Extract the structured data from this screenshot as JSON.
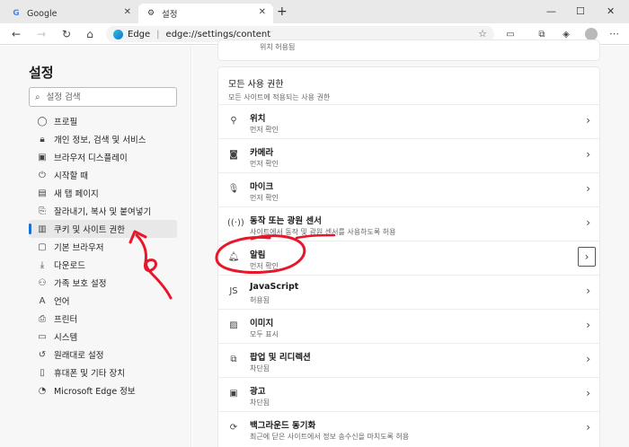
{
  "tabs": [
    {
      "title": "Google",
      "icon": "google-icon",
      "active": false
    },
    {
      "title": "설정",
      "icon": "gear-icon",
      "active": true
    }
  ],
  "address_bar": {
    "browser_name": "Edge",
    "url": "edge://settings/content"
  },
  "sidebar": {
    "title": "설정",
    "search_placeholder": "설정 검색",
    "items": [
      {
        "label": "프로필",
        "icon": "profile-icon"
      },
      {
        "label": "개인 정보, 검색 및 서비스",
        "icon": "lock-icon"
      },
      {
        "label": "브라우저 디스플레이",
        "icon": "display-icon"
      },
      {
        "label": "시작할 때",
        "icon": "power-icon"
      },
      {
        "label": "새 탭 페이지",
        "icon": "newtab-icon"
      },
      {
        "label": "잘라내기, 복사 및 붙여넣기",
        "icon": "clipboard-icon"
      },
      {
        "label": "쿠키 및 사이트 권한",
        "icon": "cookie-icon",
        "active": true
      },
      {
        "label": "기본 브라우저",
        "icon": "browser-icon"
      },
      {
        "label": "다운로드",
        "icon": "download-icon"
      },
      {
        "label": "가족 보호 설정",
        "icon": "family-icon"
      },
      {
        "label": "언어",
        "icon": "language-icon"
      },
      {
        "label": "프린터",
        "icon": "printer-icon"
      },
      {
        "label": "시스템",
        "icon": "system-icon"
      },
      {
        "label": "원래대로 설정",
        "icon": "reset-icon"
      },
      {
        "label": "휴대폰 및 기타 장치",
        "icon": "phone-icon"
      },
      {
        "label": "Microsoft Edge 정보",
        "icon": "edge-icon"
      }
    ]
  },
  "main": {
    "top_card_sub": "위치 허용됨",
    "section_title": "모든 사용 권한",
    "section_sub": "모든 사이트에 적용되는 사용 권한",
    "permissions": [
      {
        "name": "위치",
        "desc": "먼저 확인",
        "icon": "location-icon"
      },
      {
        "name": "카메라",
        "desc": "먼저 확인",
        "icon": "camera-icon"
      },
      {
        "name": "마이크",
        "desc": "먼저 확인",
        "icon": "microphone-icon"
      },
      {
        "name": "동작 또는 광원 센서",
        "desc": "사이트에서 동작 및 광원 센서를 사용하도록 허용",
        "icon": "sensor-icon"
      },
      {
        "name": "알림",
        "desc": "먼저 확인",
        "icon": "bell-icon"
      },
      {
        "name": "JavaScript",
        "desc": "허용됨",
        "icon": "javascript-icon"
      },
      {
        "name": "이미지",
        "desc": "모두 표시",
        "icon": "image-icon"
      },
      {
        "name": "팝업 및 리디렉션",
        "desc": "차단됨",
        "icon": "popup-icon"
      },
      {
        "name": "광고",
        "desc": "차단됨",
        "icon": "ads-icon"
      },
      {
        "name": "백그라운드 동기화",
        "desc": "최근에 닫은 사이트에서 정보 송수신을 마치도록 허용",
        "icon": "sync-icon"
      }
    ]
  },
  "annotation_color": "#e8162a"
}
